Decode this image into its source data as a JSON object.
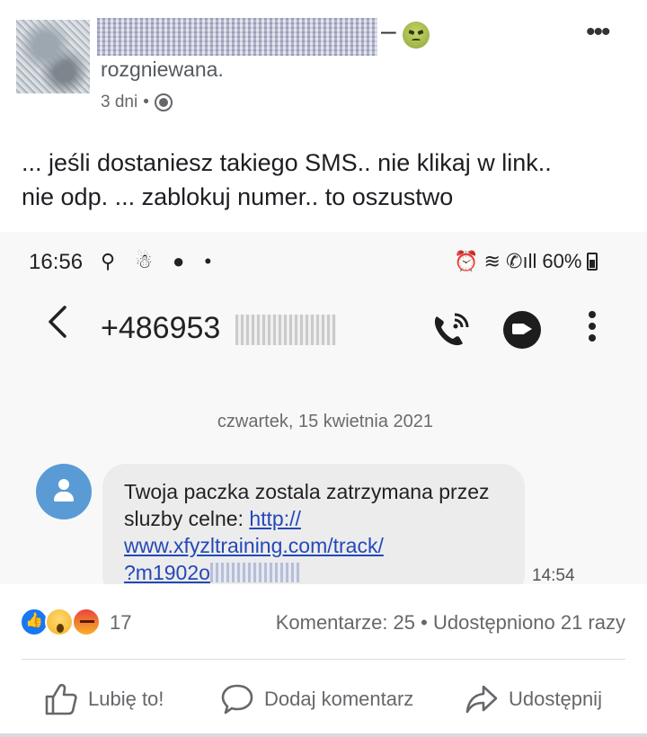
{
  "post": {
    "feeling_text": "rozgniewana.",
    "time": "3 dni",
    "separator": "•",
    "body_line1": "... jeśli  dostaniesz takiego SMS..  nie klikaj w link..",
    "body_line2": "nie odp. ... zablokuj numer.. to oszustwo",
    "dash": "–"
  },
  "phone": {
    "status_time": "16:56",
    "status_left_icons": "⚲ ☃ ● •",
    "battery": "60%",
    "contact_number": "+486953",
    "date": "czwartek, 15 kwietnia 2021",
    "message": {
      "text": "Twoja paczka zostala zatrzymana przez sluzby celne: ",
      "link_part1": "http://",
      "link_part2": "www.xfyzltraining.com/track/",
      "link_part3": "?m1902o",
      "time": "14:54"
    }
  },
  "stats": {
    "reaction_count": "17",
    "comments": "Komentarze: 25",
    "shares": "Udostępniono 21 razy",
    "separator": "•"
  },
  "actions": {
    "like": "Lubię to!",
    "comment": "Dodaj komentarz",
    "share": "Udostępnij"
  },
  "colors": {
    "link": "#2448b8",
    "like_blue": "#1877f2",
    "contact_avatar": "#5b9bd5",
    "muted": "#65676b"
  }
}
